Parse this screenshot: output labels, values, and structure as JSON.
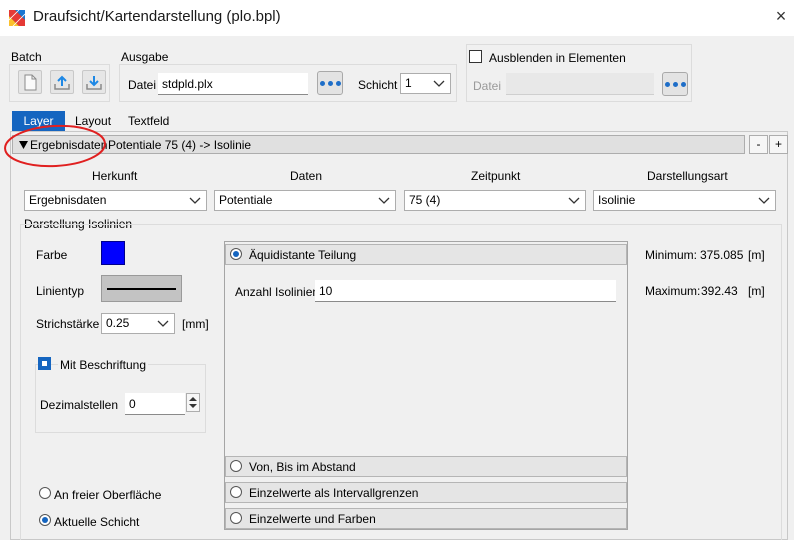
{
  "window": {
    "title": "Draufsicht/Kartendarstellung (plo.bpl)",
    "close_icon": "×"
  },
  "batch": {
    "label": "Batch",
    "icons": [
      "new-file-icon",
      "upload-icon",
      "download-icon"
    ]
  },
  "ausgabe": {
    "label": "Ausgabe",
    "file_label": "Datei",
    "file_value": "stdpld.plx",
    "layer_label": "Schicht",
    "layer_value": "1"
  },
  "hide": {
    "label": "Ausblenden in Elementen",
    "file_label": "Datei",
    "file_value": "",
    "checked": false
  },
  "tabs": [
    {
      "label": "Layer",
      "active": true
    },
    {
      "label": "Layout",
      "active": false
    },
    {
      "label": "Textfeld",
      "active": false
    }
  ],
  "layer_header": {
    "title": "Ergebnisdaten",
    "summary": "Potentiale 75 (4) -> Isolinie",
    "minus": "-",
    "plus": "+"
  },
  "selectors": {
    "headers": [
      "Herkunft",
      "Daten",
      "Zeitpunkt",
      "Darstellungsart"
    ],
    "values": [
      "Ergebnisdaten",
      "Potentiale",
      "75 (4)",
      "Isolinie"
    ]
  },
  "isolines": {
    "section_label": "Darstellung Isolinien",
    "color_label": "Farbe",
    "color": "#0000ff",
    "linetype_label": "Linientyp",
    "stroke_label": "Strichstärke",
    "stroke_value": "0.25",
    "stroke_unit": "[mm]",
    "caption_label": "Mit Beschriftung",
    "caption_checked": true,
    "decimals_label": "Dezimalstellen",
    "decimals_value": "0"
  },
  "division": {
    "equidistant_label": "Äquidistante Teilung",
    "count_label": "Anzahl Isolinien",
    "count_value": "10",
    "options": [
      "Von, Bis im Abstand",
      "Einzelwerte als Intervallgrenzen",
      "Einzelwerte und Farben"
    ]
  },
  "range": {
    "min_label": "Minimum:",
    "min_value": "375.085",
    "max_label": "Maximum:",
    "max_value": "392.43",
    "unit": "[m]"
  },
  "position": {
    "options": [
      "An freier Oberfläche",
      "Aktuelle Schicht"
    ],
    "selected_index": 1
  },
  "colors": {
    "accent": "#1565c0",
    "annotation": "#e02020"
  }
}
